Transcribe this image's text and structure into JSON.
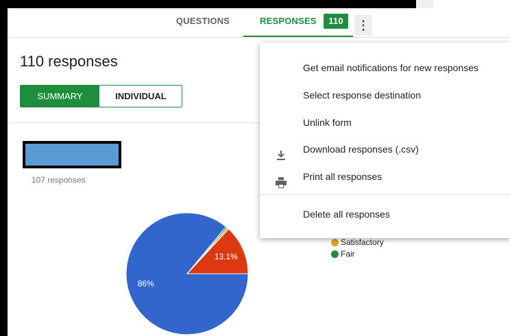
{
  "tabs": {
    "questions": "QUESTIONS",
    "responses": "RESPONSES",
    "response_count": "110"
  },
  "summary": {
    "title": "110 responses",
    "summary_button": "SUMMARY",
    "individual_button": "INDIVIDUAL"
  },
  "question": {
    "response_count": "107 responses"
  },
  "menu": {
    "items": [
      {
        "label": "Get email notifications for new responses",
        "icon": ""
      },
      {
        "label": "Select response destination",
        "icon": ""
      },
      {
        "label": "Unlink form",
        "icon": ""
      },
      {
        "label": "Download responses (.csv)",
        "icon": "download-icon"
      },
      {
        "label": "Print all responses",
        "icon": "print-icon"
      },
      {
        "label": "Delete all responses",
        "icon": ""
      }
    ]
  },
  "legend": [
    {
      "label": "Satisfactory",
      "color": "#e8a31f"
    },
    {
      "label": "Fair",
      "color": "#1e8e3e"
    }
  ],
  "chart_data": {
    "type": "pie",
    "slices": [
      {
        "label": "86%",
        "value": 86,
        "color": "#3366cc"
      },
      {
        "label": "13.1%",
        "value": 13.1,
        "color": "#dc3912"
      },
      {
        "label": "",
        "value": 0.5,
        "color": "#e8a31f"
      },
      {
        "label": "",
        "value": 0.4,
        "color": "#1e8e3e"
      }
    ]
  }
}
